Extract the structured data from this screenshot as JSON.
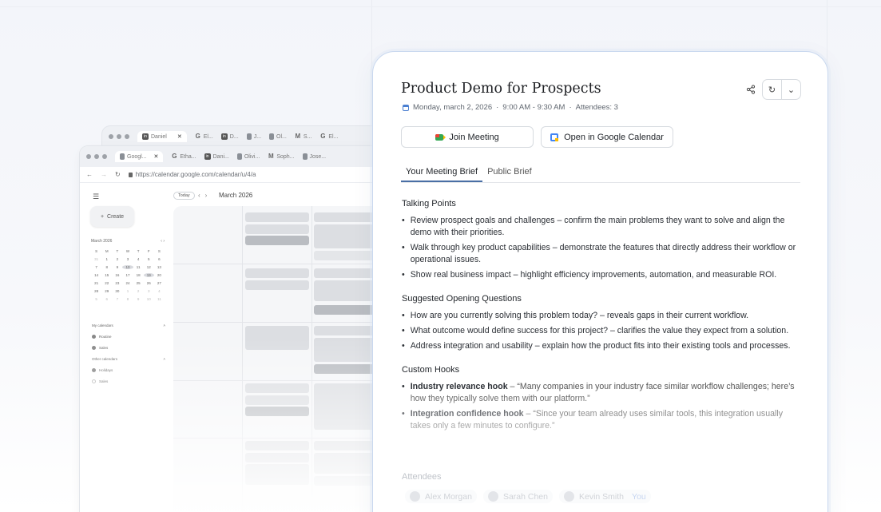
{
  "browser_back": {
    "tabs": [
      {
        "label": "Daniel",
        "active": true
      },
      {
        "label": "El..."
      },
      {
        "label": "D..."
      },
      {
        "label": "J..."
      },
      {
        "label": "Ol..."
      },
      {
        "label": "S..."
      },
      {
        "label": "El..."
      }
    ]
  },
  "browser_front": {
    "tabs": [
      {
        "label": "Googl...",
        "active": true
      },
      {
        "label": "Etha..."
      },
      {
        "label": "Dani..."
      },
      {
        "label": "Olivi..."
      },
      {
        "label": "Soph..."
      },
      {
        "label": "Jose..."
      }
    ],
    "url": "https://calendar.google.com/calendar/u/4/a"
  },
  "calendar": {
    "today_label": "Today",
    "month_title": "March 2026",
    "create_label": "Create",
    "mini_month": "March 2026",
    "weekdays": [
      "S",
      "M",
      "T",
      "W",
      "T",
      "F",
      "S"
    ],
    "days": [
      [
        "31",
        "1",
        "2",
        "3",
        "4",
        "5",
        "6"
      ],
      [
        "7",
        "8",
        "9",
        "10",
        "11",
        "12",
        "13"
      ],
      [
        "14",
        "15",
        "16",
        "17",
        "18",
        "19",
        "20"
      ],
      [
        "21",
        "22",
        "23",
        "24",
        "25",
        "26",
        "27"
      ],
      [
        "28",
        "29",
        "30",
        "1",
        "2",
        "3",
        "4"
      ],
      [
        "5",
        "6",
        "7",
        "8",
        "9",
        "10",
        "11"
      ]
    ],
    "my_calendars_label": "My calendars",
    "my_calendars": [
      "Routine",
      "Sales"
    ],
    "other_calendars_label": "Other calendars",
    "other_calendars": [
      "Holidays",
      "Sales"
    ]
  },
  "brief": {
    "title": "Product Demo for Prospects",
    "date": "Monday, march 2, 2026",
    "time": "9:00 AM - 9:30 AM",
    "attendees_count": "Attendees: 3",
    "join_label": "Join Meeting",
    "open_calendar_label": "Open in Google Calendar",
    "tabs": [
      "Your Meeting Brief",
      "Public Brief"
    ],
    "talking_points_heading": "Talking Points",
    "talking_points": [
      {
        "bold": "Review prospect goals and challenges",
        "rest": " – confirm the main problems they want to solve and align the demo with their priorities."
      },
      {
        "bold": "Walk through key product capabilities",
        "rest": " – demonstrate the features that directly address their workflow or operational issues."
      },
      {
        "bold": "Show real business impact",
        "rest": " – highlight efficiency improvements, automation, and measurable ROI."
      }
    ],
    "questions_heading": "Suggested Opening Questions",
    "questions": [
      {
        "bold": "How are you currently solving this problem today?",
        "rest": " – reveals gaps in their current workflow."
      },
      {
        "bold": "What outcome would define success for this project?",
        "rest": " – clarifies the value they expect from a solution."
      },
      {
        "bold": "Address integration and usability",
        "rest": " – explain how the product fits into their existing tools and processes."
      }
    ],
    "hooks_heading": "Custom Hooks",
    "hooks": [
      {
        "bold": "Industry relevance hook",
        "rest": " – “Many companies in your industry face similar workflow challenges; here’s how they typically solve them with our platform.”"
      },
      {
        "bold": "Integration confidence hook",
        "rest": " – “Since your team already uses similar tools, this integration usually takes only a few minutes to configure.”"
      }
    ],
    "attendees_heading": "Attendees",
    "attendees": [
      "Alex Morgan",
      "Sarah Chen",
      "Kevin Smith"
    ],
    "you_label": "You"
  }
}
